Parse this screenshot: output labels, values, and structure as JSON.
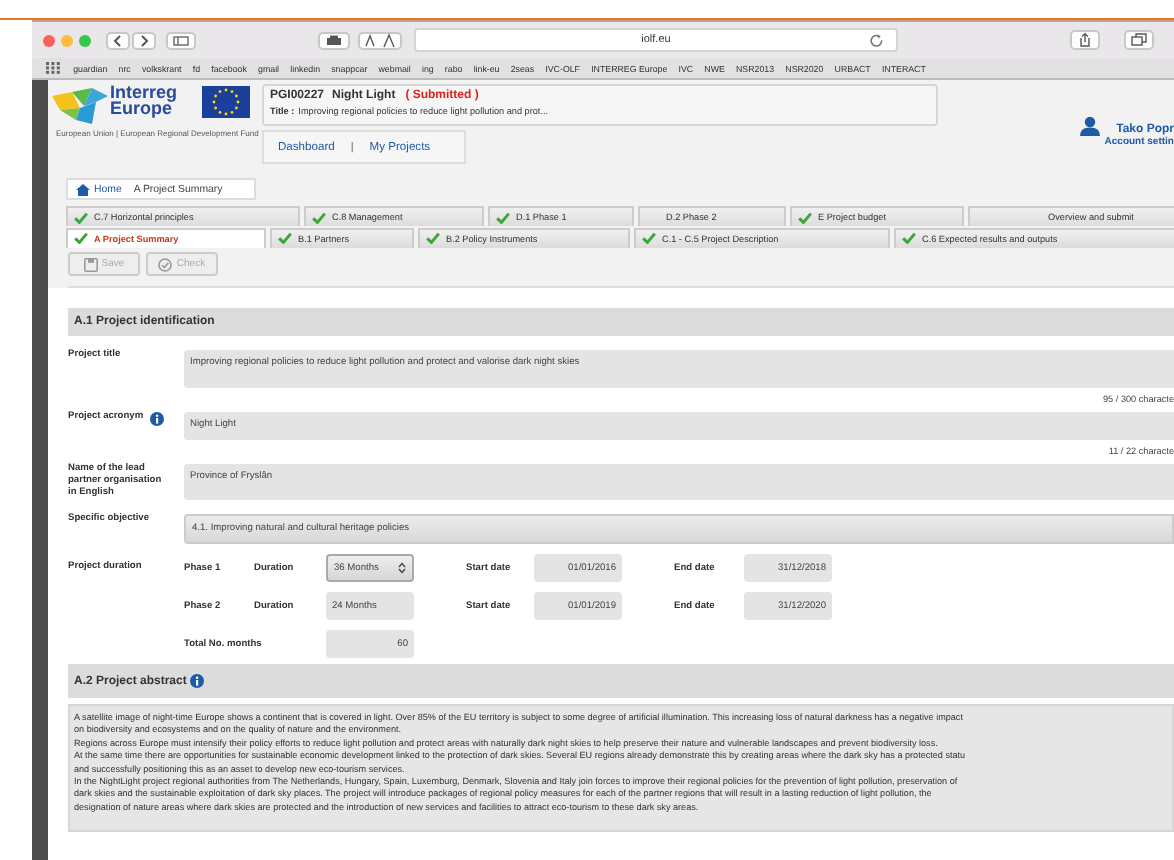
{
  "browser": {
    "url": "iolf.eu",
    "bookmarks": [
      "guardian",
      "nrc",
      "volkskrant",
      "fd",
      "facebook",
      "gmail",
      "linkedin",
      "snappcar",
      "webmail",
      "ing",
      "rabo",
      "link-eu",
      "2seas",
      "IVC-OLF",
      "INTERREG Europe",
      "IVC",
      "NWE",
      "NSR2013",
      "NSR2020",
      "URBACT",
      "INTERACT"
    ]
  },
  "logo": {
    "name_line1": "Interreg",
    "name_line2": "Europe",
    "tagline": "European Union | European Regional Development Fund"
  },
  "project": {
    "code": "PGI00227",
    "acronym": "Night Light",
    "status": "( Submitted )",
    "title_label": "Title :",
    "title": "Improving regional policies to reduce light pollution and prot..."
  },
  "nav": [
    "Dashboard",
    "My Projects"
  ],
  "nav_separator": "|",
  "user": {
    "name": "Tako Popr",
    "account": "Account settin"
  },
  "breadcrumb": [
    "Home",
    "A Project Summary"
  ],
  "tab_rows": [
    [
      {
        "label": "C.7 Horizontal principles",
        "complete": true,
        "selected": false
      },
      {
        "label": "C.8 Management",
        "complete": true,
        "selected": false
      },
      {
        "label": "D.1 Phase 1",
        "complete": true,
        "selected": false
      },
      {
        "label": "D.2 Phase 2",
        "complete": false,
        "selected": false
      },
      {
        "label": "E Project budget",
        "complete": true,
        "selected": false
      },
      {
        "label": "Overview and submit",
        "complete": false,
        "selected": false
      }
    ],
    [
      {
        "label": "A Project Summary",
        "complete": true,
        "selected": true
      },
      {
        "label": "B.1 Partners",
        "complete": true,
        "selected": false
      },
      {
        "label": "B.2 Policy Instruments",
        "complete": true,
        "selected": false
      },
      {
        "label": "C.1 - C.5 Project Description",
        "complete": true,
        "selected": false
      },
      {
        "label": "C.6 Expected results and outputs",
        "complete": true,
        "selected": false
      }
    ]
  ],
  "toolbar": [
    {
      "kind": "save",
      "label": "Save",
      "disabled": true
    },
    {
      "kind": "check",
      "label": "Check",
      "disabled": true
    }
  ],
  "identification": {
    "heading": "A.1 Project identification",
    "fields": [
      {
        "kind": "textarea",
        "label": "Project title",
        "info": false,
        "value": "Improving regional policies to reduce light pollution and protect and valorise dark night skies",
        "counter": "95 / 300 characte"
      },
      {
        "kind": "text",
        "label": "Project acronym",
        "info": true,
        "value": "Night Light",
        "counter": "11 / 22 characte"
      },
      {
        "kind": "text",
        "label": "Name of the lead partner organisation in English",
        "info": false,
        "value": "Province of Fryslân"
      },
      {
        "kind": "select",
        "label": "Specific objective",
        "info": false,
        "value": "4.1. Improving natural and cultural heritage policies"
      }
    ],
    "duration": {
      "label": "Project duration",
      "phases": [
        {
          "phase": "Phase 1",
          "duration_label": "Duration",
          "duration": "36 Months",
          "kind": "select",
          "start_label": "Start date",
          "start": "01/01/2016",
          "end_label": "End date",
          "end": "31/12/2018"
        },
        {
          "phase": "Phase 2",
          "duration_label": "Duration",
          "duration": "24 Months",
          "kind": "text",
          "start_label": "Start date",
          "start": "01/01/2019",
          "end_label": "End date",
          "end": "31/12/2020"
        }
      ],
      "total_label": "Total No. months",
      "total": "60"
    }
  },
  "abstract": {
    "heading": "A.2 Project abstract",
    "info": true,
    "paragraphs": [
      "A satellite image of night-time Europe shows a continent that is covered in light. Over 85% of the EU territory is subject to some degree of artificial illumination. This increasing loss of natural darkness has a negative impact\non biodiversity and ecosystems and on the quality of nature and the environment.",
      "Regions across Europe must intensify their policy efforts to reduce light pollution and protect areas with naturally dark night skies to help preserve their nature and vulnerable landscapes and prevent biodiversity loss.",
      "At the same time there are opportunities for sustainable economic development linked to the protection of dark skies. Several EU regions already demonstrate this by creating areas where the dark sky has a protected statu\nand successfully positioning this as an asset to develop new eco-tourism services.",
      "In the NightLight project regional authorities from The Netherlands, Hungary, Spain, Luxemburg, Denmark, Slovenia and Italy join forces to improve their regional policies for the prevention of light pollution, preservation of\ndark skies and the sustainable exploitation of dark sky places. The project will introduce packages of regional policy measures for each of the partner regions that will result in a lasting reduction of light pollution, the\ndesignation of nature areas where dark skies are protected and the introduction of new services and facilities to attract eco-tourism to these dark sky areas."
    ]
  }
}
